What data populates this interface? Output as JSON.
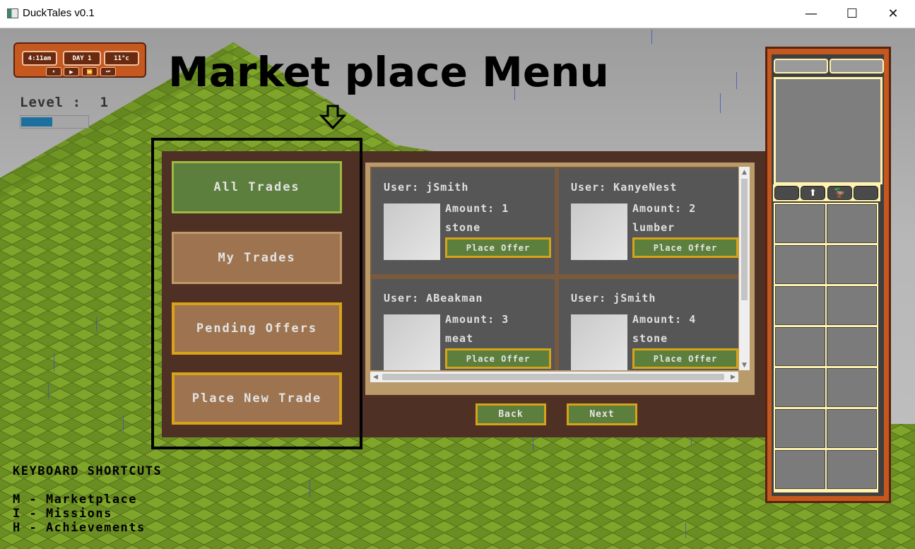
{
  "window": {
    "title": "DuckTales v0.1",
    "minimize_glyph": "—",
    "maximize_glyph": "☐",
    "close_glyph": "✕"
  },
  "hud": {
    "time": "4:11am",
    "day": "DAY 1",
    "temperature": "11°c",
    "speed_buttons": [
      "⏸",
      "▶",
      "⏩",
      "⏭"
    ],
    "level_label": "Level :",
    "level_value": "1",
    "level_progress": 0.47
  },
  "annotation": {
    "title": "Market place Menu",
    "arrow": "down-arrow-icon"
  },
  "market": {
    "nav": [
      "All Trades",
      "My Trades",
      "Pending Offers",
      "Place New Trade"
    ],
    "active_nav": "All Trades",
    "trades": [
      {
        "user": "User: jSmith",
        "amount": "Amount: 1",
        "resource": "stone",
        "button": "Place Offer"
      },
      {
        "user": "User: KanyeNest",
        "amount": "Amount: 2",
        "resource": "lumber",
        "button": "Place Offer"
      },
      {
        "user": "User: ABeakman",
        "amount": "Amount: 3",
        "resource": "meat",
        "button": "Place Offer"
      },
      {
        "user": "User: jSmith",
        "amount": "Amount: 4",
        "resource": "stone",
        "button": "Place Offer"
      }
    ],
    "back_label": "Back",
    "next_label": "Next"
  },
  "shortcuts": {
    "heading": "KEYBOARD SHORTCUTS",
    "items": [
      "M - Marketplace",
      "I - Missions",
      "H - Achievements"
    ]
  },
  "inventory": {
    "tabs": [
      "",
      "⬆",
      "🦆",
      ""
    ],
    "slot_count": 14
  },
  "colors": {
    "panel_brown": "#4f3025",
    "active_green": "#5c7f3e",
    "highlight_gold": "#d8a317",
    "hud_orange": "#c5581f"
  }
}
